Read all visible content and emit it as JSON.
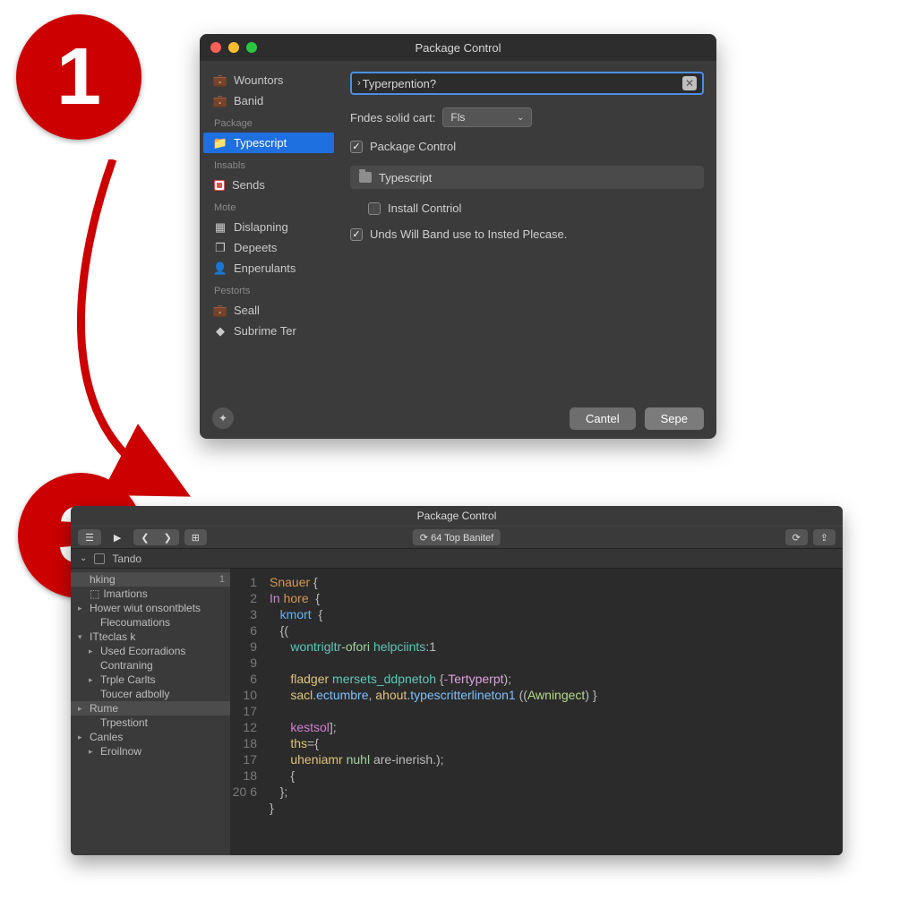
{
  "badges": {
    "one": "1",
    "three": "3"
  },
  "win1": {
    "title": "Package Control",
    "sidebar": {
      "top": [
        {
          "icon": "briefcase-icon",
          "label": "Wountors"
        },
        {
          "icon": "briefcase-icon",
          "label": "Banid"
        }
      ],
      "package_header": "Package",
      "package_item": "Typescript",
      "insabls_header": "Insabls",
      "sends_item": "Sends",
      "mote_header": "Mote",
      "mote_items": [
        {
          "icon": "grid-icon",
          "label": "Dislapning"
        },
        {
          "icon": "layers-icon",
          "label": "Depeets"
        },
        {
          "icon": "person-icon",
          "label": "Enperulants"
        }
      ],
      "pestorts_header": "Pestorts",
      "pestorts_items": [
        {
          "icon": "briefcase-icon",
          "label": "Seall"
        },
        {
          "icon": "diamond-icon",
          "label": "Subrime Ter"
        }
      ]
    },
    "search": {
      "value": "Typerpention?"
    },
    "findes_label": "Fndes solid cart:",
    "findes_value": "Fls",
    "chk_package_control": "Package Control",
    "section_typescript": "Typescript",
    "chk_install": "Install Contriol",
    "chk_undo": "Unds Will Band use to Insted Plecase.",
    "footer": {
      "cancel": "Cantel",
      "save": "Sepe",
      "round_glyph": "✦"
    }
  },
  "win2": {
    "title": "Package Control ",
    "menu_glyph": "☰",
    "play_glyph": "▶",
    "nav_back": "❮",
    "nav_fwd": "❯",
    "grid_glyph": "⊞",
    "center_pill": "⟳ 64 Top Banitef",
    "reload_glyph": "⟳",
    "export_glyph": "⇪",
    "crumb_chev": "⌄",
    "crumb_label": "Tando",
    "tree": [
      {
        "label": "hking",
        "d": 0,
        "arrow": "",
        "sel": true,
        "num": "1"
      },
      {
        "label": "Imartions",
        "d": 0,
        "arrow": "",
        "icon": "cube"
      },
      {
        "label": "Hower wiut onsontblets",
        "d": 0,
        "arrow": "▸"
      },
      {
        "label": "Flecoumations",
        "d": 1
      },
      {
        "label": "ITteclas k",
        "d": 0,
        "arrow": "▾"
      },
      {
        "label": "Used Ecorradions",
        "d": 1,
        "arrow": "▸"
      },
      {
        "label": "Contraning",
        "d": 1
      },
      {
        "label": "Trple Carlts",
        "d": 1,
        "arrow": "▸"
      },
      {
        "label": "Toucer adbolly",
        "d": 1
      },
      {
        "label": "Rume",
        "d": 0,
        "arrow": "▸",
        "sel": true
      },
      {
        "label": "Trpestiont",
        "d": 1
      },
      {
        "label": "Canles",
        "d": 0,
        "arrow": "▸"
      },
      {
        "label": "Eroilnow",
        "d": 1,
        "arrow": "▸"
      }
    ],
    "line_numbers": [
      "1",
      "2",
      "3",
      "6",
      "9",
      "9",
      "6",
      "10",
      "17",
      "12",
      "18",
      "17",
      "18",
      "20 6"
    ],
    "code": {
      "l1a": "Snauer",
      "l1b": "{",
      "l2a": "In",
      "l2b": "hore",
      "l2c": "{",
      "l3a": "kmort",
      "l3b": "{",
      "l4": "{(",
      "l5a": "wontrigltr",
      "l5b": "-",
      "l5c": "ofori",
      "l5d": "helpciints",
      "l5e": ":1",
      "l7a": "fladger",
      "l7b": "mersets_ddpnetoh",
      "l7c": "{",
      "l7d": "-",
      "l7e": "Tertyperpt",
      "l7f": ");",
      "l8a": "sacl",
      "l8b": ".",
      "l8c": "ectumbre",
      "l8d": ", ",
      "l8e": "ahout",
      "l8f": ".",
      "l8g": "typescritterlineton1",
      "l8h": " (",
      "l8i": "(",
      "l8j": "Awningect",
      "l8k": ")",
      "l8l": " }",
      "l10a": "kestsol",
      "l10b": "];",
      "l11a": "ths",
      "l11b": "={",
      "l12a": "uheniamr",
      "l12b": "nuhl",
      "l12c": " are-inerish.);",
      "l13": "{",
      "l14": "};",
      "l15": "}"
    }
  }
}
